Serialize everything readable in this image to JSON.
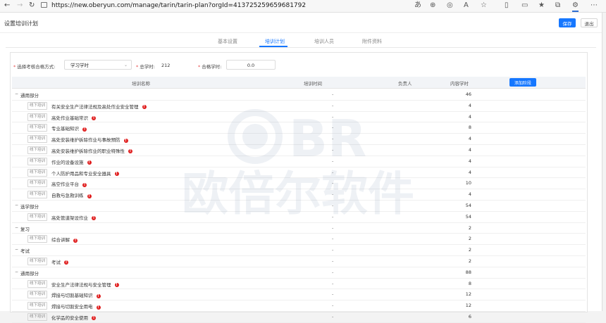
{
  "browser": {
    "url": "https://new.oberyun.com/manage/tarin/tarin-plan?orgId=413725259659681792"
  },
  "header": {
    "title": "设置培训计划",
    "save_label": "保存",
    "exit_label": "退出"
  },
  "tabs": [
    {
      "label": "基本设置"
    },
    {
      "label": "培训计划",
      "active": true
    },
    {
      "label": "培训人员"
    },
    {
      "label": "附件资料"
    }
  ],
  "form": {
    "method_label": "选择考核合格方式:",
    "method_value": "学习学时",
    "total_label": "总学时:",
    "total_value": "212",
    "pass_label": "合格学时:",
    "pass_value": "0.0"
  },
  "table": {
    "columns": {
      "name": "培训名称",
      "time": "培训时间",
      "owner": "负责人",
      "hours": "内容学时"
    },
    "add_stage_label": "添加阶段",
    "rows": [
      {
        "type": "group",
        "name": "通用部分",
        "time": "-",
        "hours": "46"
      },
      {
        "type": "item",
        "tag": "线下培训",
        "name": "有关安全生产法律法规及高处作业安全管理",
        "time": "-",
        "hours": "4"
      },
      {
        "type": "item",
        "tag": "线下培训",
        "name": "高处作业基础常识",
        "time": "-",
        "hours": "4"
      },
      {
        "type": "item",
        "tag": "线下培训",
        "name": "专业基础知识",
        "time": "-",
        "hours": "8"
      },
      {
        "type": "item",
        "tag": "线下培训",
        "name": "高处安装维护拆除作业与事故预防",
        "time": "-",
        "hours": "4"
      },
      {
        "type": "item",
        "tag": "线下培训",
        "name": "高处安装维护拆除作业的职业特殊性",
        "time": "-",
        "hours": "4"
      },
      {
        "type": "item",
        "tag": "线下培训",
        "name": "作业的设备设施",
        "time": "-",
        "hours": "4"
      },
      {
        "type": "item",
        "tag": "线下培训",
        "name": "个人防护用品和专业安全器具",
        "time": "-",
        "hours": "4"
      },
      {
        "type": "item",
        "tag": "线下培训",
        "name": "高空作业平台",
        "time": "-",
        "hours": "10"
      },
      {
        "type": "item",
        "tag": "线下培训",
        "name": "自救与急救训练",
        "time": "-",
        "hours": "4"
      },
      {
        "type": "group",
        "name": "选学部分",
        "time": "-",
        "hours": "54"
      },
      {
        "type": "item",
        "tag": "线下培训",
        "name": "高处管道架设作业",
        "time": "-",
        "hours": "54"
      },
      {
        "type": "group",
        "name": "复习",
        "time": "-",
        "hours": "2"
      },
      {
        "type": "item",
        "tag": "线下培训",
        "name": "综合讲解",
        "time": "-",
        "hours": "2"
      },
      {
        "type": "group",
        "name": "考试",
        "time": "-",
        "hours": "2"
      },
      {
        "type": "item",
        "tag": "线下培训",
        "name": "考试",
        "time": "-",
        "hours": "2"
      },
      {
        "type": "group",
        "name": "通用部分",
        "time": "-",
        "hours": "88"
      },
      {
        "type": "item",
        "tag": "线下培训",
        "name": "安全生产法律法规与安全管理",
        "time": "-",
        "hours": "8"
      },
      {
        "type": "item",
        "tag": "线下培训",
        "name": "焊接与切割基础知识",
        "time": "-",
        "hours": "12"
      },
      {
        "type": "item",
        "tag": "线下培训",
        "name": "焊接与切割安全用电",
        "time": "-",
        "hours": "12"
      },
      {
        "type": "item",
        "tag": "线下培训",
        "name": "化学品的安全使用",
        "time": "-",
        "hours": "6"
      }
    ]
  },
  "watermark": {
    "text": "欧倍尔软件",
    "logo_text": "BR"
  },
  "colors": {
    "accent": "#1677ff",
    "warn": "#e02020"
  }
}
